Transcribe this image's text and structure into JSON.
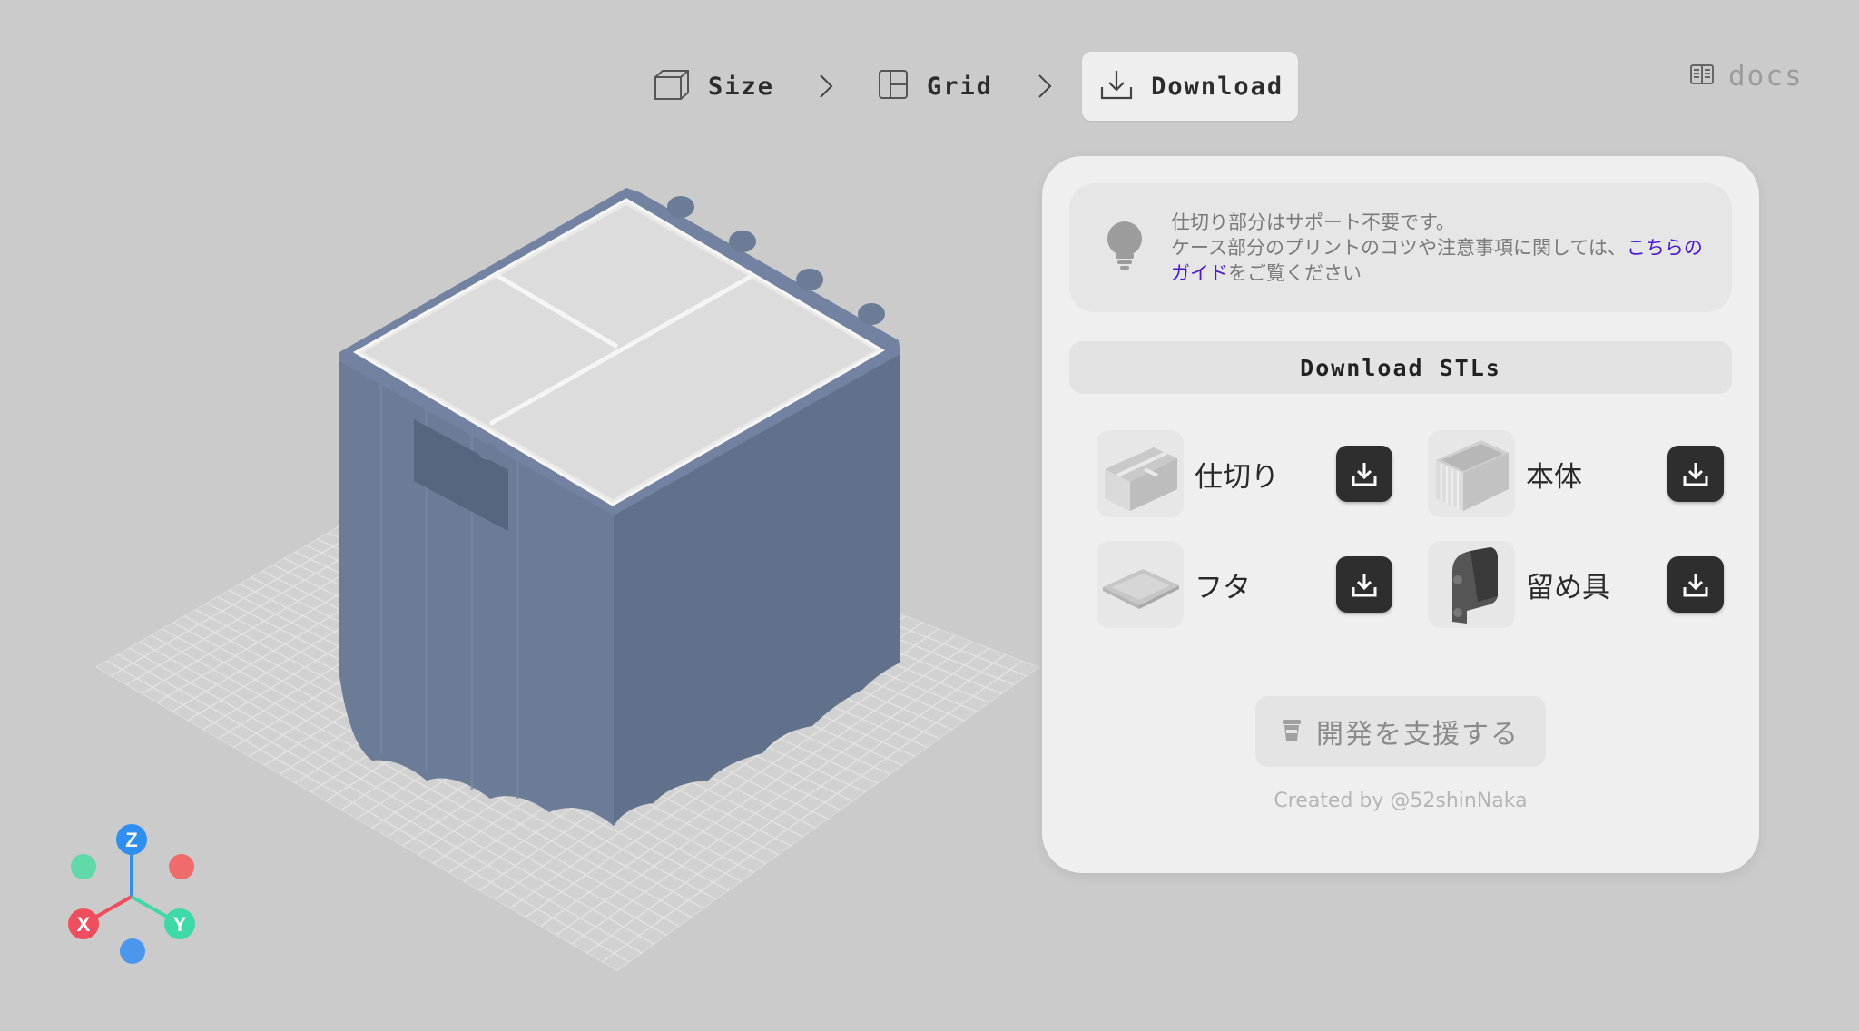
{
  "stepper": {
    "steps": [
      {
        "label": "Size",
        "icon": "box-icon"
      },
      {
        "label": "Grid",
        "icon": "layout-icon"
      },
      {
        "label": "Download",
        "icon": "download-icon",
        "active": true
      }
    ]
  },
  "docs": {
    "label": "docs",
    "icon": "book-icon"
  },
  "axis": {
    "z": "Z",
    "x": "X",
    "y": "Y"
  },
  "colors": {
    "model": "#65758f",
    "accent_link": "#4a18d6",
    "button_dark": "#2e2e2e",
    "axis_z": "#2f8ff0",
    "axis_x": "#f04d5f",
    "axis_y": "#3ed9a8"
  },
  "panel": {
    "tip": {
      "line1": "仕切り部分はサポート不要です。",
      "line2_prefix": "ケース部分のプリントのコツや注意事項に関しては、",
      "link": "こちらのガイド",
      "line2_suffix": "をご覧ください"
    },
    "download_all_label": "Download STLs",
    "parts": [
      {
        "name": "仕切り"
      },
      {
        "name": "本体"
      },
      {
        "name": "フタ"
      },
      {
        "name": "留め具"
      }
    ],
    "support_label": "開発を支援する",
    "credit": "Created by @52shinNaka"
  }
}
